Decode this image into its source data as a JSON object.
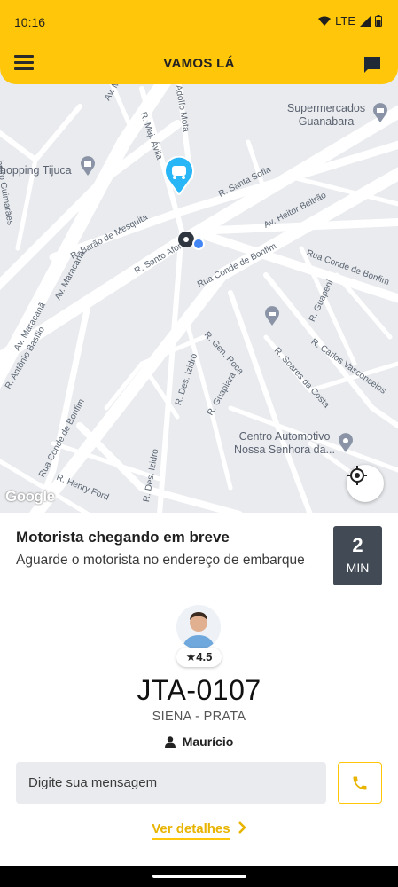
{
  "status": {
    "time": "10:16",
    "network": "LTE"
  },
  "appbar": {
    "title": "VAMOS LÁ"
  },
  "map": {
    "streets": [
      "Av. Maracanã",
      "R. Maj. Ávila",
      "Adolfo Mota",
      "R. Santa Sofia",
      "Av. Heitor Beltrão",
      "R. Barão de Mesquita",
      "R. Santo Afonso",
      "Rua Conde de Bonfim",
      "Rua Conde de Bonfim",
      "R. Guapeni",
      "R. Carlos Vasconcelos",
      "R. Gen. Roca",
      "R. Soares da Costa",
      "R. Guapiara",
      "R. Des. Izidro",
      "Av. Maracanã",
      "R. Antônio Basílio",
      "Rua Conde de Bonfim",
      "R. Henry Ford",
      "R. Des. Izidro",
      "beiro Guimarães",
      "Av. Ma"
    ],
    "pois": [
      {
        "name": "Supermercados\nGuanabara"
      },
      {
        "name": "hopping Tijuca"
      },
      {
        "name": "Centro Automotivo\nNossa Senhora da..."
      }
    ],
    "attribution": "Google"
  },
  "trip": {
    "title": "Motorista chegando em breve",
    "subtitle": "Aguarde o motorista no endereço de embarque",
    "eta_value": "2",
    "eta_unit": "MIN"
  },
  "driver": {
    "rating": "4.5",
    "plate": "JTA-0107",
    "car": "SIENA - PRATA",
    "name": "Maurício"
  },
  "message": {
    "placeholder": "Digite sua mensagem"
  },
  "details_link": "Ver detalhes",
  "colors": {
    "brand": "#FFC60A",
    "eta_bg": "#424a55",
    "map_bg": "#e9ebee"
  },
  "icons": [
    "menu-icon",
    "chat-icon",
    "car-pin-icon",
    "user-location-icon",
    "locate-icon",
    "star-icon",
    "person-icon",
    "phone-icon",
    "chevron-right-icon"
  ]
}
